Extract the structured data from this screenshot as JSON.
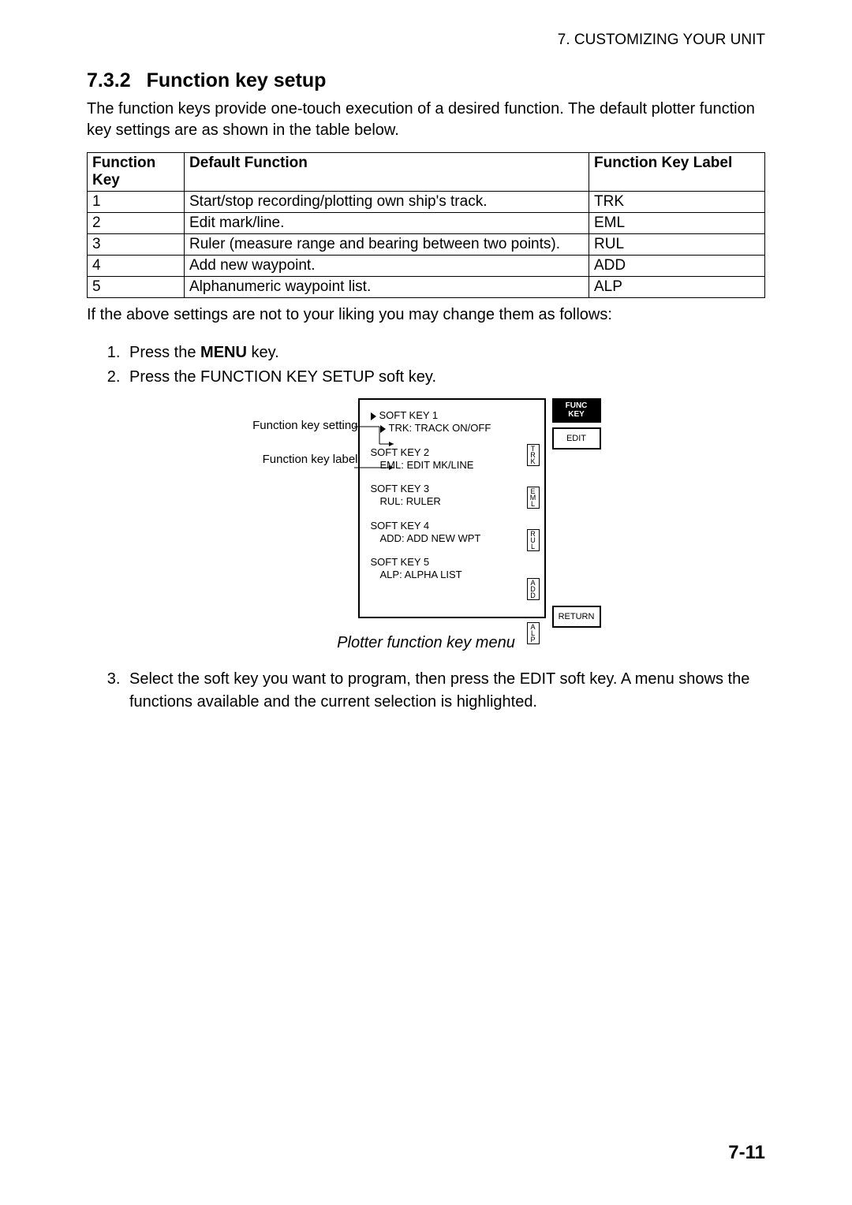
{
  "running_head": "7. CUSTOMIZING YOUR UNIT",
  "section_number": "7.3.2",
  "section_title": "Function key setup",
  "intro": "The function keys provide one-touch execution of a desired function. The default plotter function key settings are as shown in the table below.",
  "table": {
    "headers": {
      "c1": "Function Key",
      "c2": "Default Function",
      "c3": "Function Key Label"
    },
    "rows": [
      {
        "key": "1",
        "fn": "Start/stop recording/plotting own ship's track.",
        "label": "TRK"
      },
      {
        "key": "2",
        "fn": "Edit mark/line.",
        "label": "EML"
      },
      {
        "key": "3",
        "fn": "Ruler (measure range and bearing between two points).",
        "label": "RUL"
      },
      {
        "key": "4",
        "fn": "Add new waypoint.",
        "label": "ADD"
      },
      {
        "key": "5",
        "fn": "Alphanumeric waypoint list.",
        "label": "ALP"
      }
    ]
  },
  "after_table": "If the above settings are not to your liking you may change them as follows:",
  "steps_a": [
    {
      "pre": "Press the ",
      "bold": "MENU",
      "post": " key."
    },
    {
      "pre": "Press the FUNCTION KEY SETUP soft key.",
      "bold": "",
      "post": ""
    }
  ],
  "figure": {
    "callout1": "Function key setting",
    "callout2": "Function key label",
    "softkeys": [
      {
        "t": "SOFT KEY 1",
        "s": "TRK: TRACK ON/OFF",
        "badge": "TRK"
      },
      {
        "t": "SOFT KEY 2",
        "s": "EML: EDIT MK/LINE",
        "badge": "EML"
      },
      {
        "t": "SOFT KEY 3",
        "s": "RUL: RULER",
        "badge": "RUL"
      },
      {
        "t": "SOFT KEY 4",
        "s": "ADD: ADD NEW WPT",
        "badge": "ADD"
      },
      {
        "t": "SOFT KEY 5",
        "s": "ALP: ALPHA LIST",
        "badge": "ALP"
      }
    ],
    "side": {
      "top1": "FUNC",
      "top2": "KEY",
      "edit": "EDIT",
      "return": "RETURN"
    },
    "caption": "Plotter function key menu"
  },
  "step3": "Select the soft key you want to program, then press the EDIT soft key. A menu shows the functions available and the current selection is highlighted.",
  "page_number": "7-11"
}
